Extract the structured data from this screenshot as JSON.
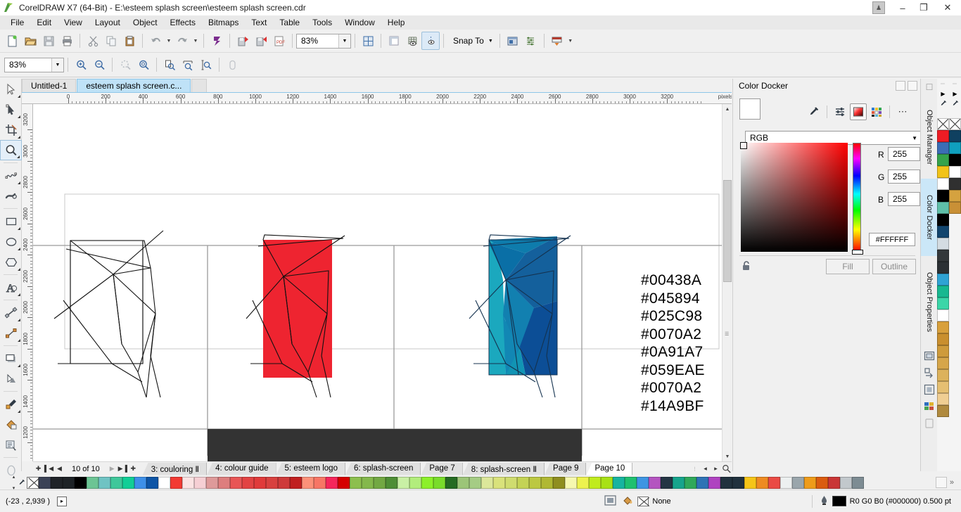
{
  "window": {
    "title": "CorelDRAW X7 (64-Bit) - E:\\esteem splash screen\\esteem splash screen.cdr",
    "logo_icon": "coreldraw-logo-icon",
    "minimize": "–",
    "maximize": "❐",
    "close": "✕",
    "account_icon": "user-account-icon"
  },
  "menubar": {
    "items": [
      {
        "label": "File",
        "accel": "F"
      },
      {
        "label": "Edit",
        "accel": "E"
      },
      {
        "label": "View",
        "accel": "V"
      },
      {
        "label": "Layout",
        "accel": "L"
      },
      {
        "label": "Object",
        "accel": "O"
      },
      {
        "label": "Effects",
        "accel": "c"
      },
      {
        "label": "Bitmaps",
        "accel": "B"
      },
      {
        "label": "Text",
        "accel": "x"
      },
      {
        "label": "Table",
        "accel": "T"
      },
      {
        "label": "Tools",
        "accel": "o"
      },
      {
        "label": "Window",
        "accel": "W"
      },
      {
        "label": "Help",
        "accel": "H"
      }
    ]
  },
  "toolbar_standard": {
    "buttons": [
      {
        "name": "new-document-icon",
        "tip": "New"
      },
      {
        "name": "open-document-icon",
        "tip": "Open"
      },
      {
        "name": "save-document-icon",
        "tip": "Save"
      },
      {
        "name": "print-icon",
        "tip": "Print"
      },
      {
        "name": "cut-icon",
        "tip": "Cut"
      },
      {
        "name": "copy-icon",
        "tip": "Copy"
      },
      {
        "name": "paste-icon",
        "tip": "Paste"
      },
      {
        "name": "undo-icon",
        "tip": "Undo"
      },
      {
        "name": "redo-icon",
        "tip": "Redo"
      },
      {
        "name": "corel-connect-icon",
        "tip": "Search Content"
      },
      {
        "name": "import-icon",
        "tip": "Import"
      },
      {
        "name": "export-icon",
        "tip": "Export"
      },
      {
        "name": "publish-pdf-icon",
        "tip": "Publish to PDF"
      }
    ],
    "zoom_value": "83%",
    "fullscreen_icon": "full-screen-preview-icon",
    "show_rulers_icon": "show-rulers-icon",
    "show_grid_icon": "show-grid-icon",
    "show_guides_icon": "show-guides-icon",
    "snap_to_label": "Snap To",
    "options_icon": "options-icon",
    "object-styles_icon": "object-styles-icon",
    "application_launcher_icon": "application-launcher-icon"
  },
  "toolbar_property": {
    "zoom_value": "83%",
    "buttons": [
      {
        "name": "zoom-in-icon"
      },
      {
        "name": "zoom-out-icon"
      },
      {
        "name": "zoom-to-selected-icon"
      },
      {
        "name": "zoom-to-all-objects-icon"
      },
      {
        "name": "zoom-to-page-icon"
      },
      {
        "name": "zoom-to-page-width-icon"
      },
      {
        "name": "zoom-to-page-height-icon"
      },
      {
        "name": "toggle-view-icon"
      }
    ]
  },
  "toolbox": {
    "tools": [
      {
        "name": "pick-tool",
        "label": "Pick",
        "flyout": true,
        "active": false
      },
      {
        "name": "shape-tool",
        "label": "Shape",
        "flyout": true,
        "active": false
      },
      {
        "name": "crop-tool",
        "label": "Crop",
        "flyout": true,
        "active": false
      },
      {
        "name": "zoom-tool",
        "label": "Zoom",
        "flyout": true,
        "active": true
      },
      {
        "name": "freehand-tool",
        "label": "Freehand",
        "flyout": true,
        "active": false
      },
      {
        "name": "artistic-media-tool",
        "label": "Artistic Media",
        "flyout": false,
        "active": false
      },
      {
        "name": "rectangle-tool",
        "label": "Rectangle",
        "flyout": true,
        "active": false
      },
      {
        "name": "ellipse-tool",
        "label": "Ellipse",
        "flyout": true,
        "active": false
      },
      {
        "name": "polygon-tool",
        "label": "Polygon",
        "flyout": true,
        "active": false
      },
      {
        "name": "text-tool",
        "label": "Text",
        "flyout": true,
        "active": false
      },
      {
        "name": "parallel-dimension-tool",
        "label": "Parallel Dimension",
        "flyout": true,
        "active": false
      },
      {
        "name": "straight-line-connector-tool",
        "label": "Straight-Line Connector",
        "flyout": true,
        "active": false
      },
      {
        "name": "drop-shadow-tool",
        "label": "Drop Shadow",
        "flyout": true,
        "active": false
      },
      {
        "name": "transparency-tool",
        "label": "Transparency",
        "flyout": false,
        "active": false
      },
      {
        "name": "color-eyedropper-tool",
        "label": "Color Eyedropper",
        "flyout": true,
        "active": false
      },
      {
        "name": "interactive-fill-tool",
        "label": "Interactive Fill",
        "flyout": false,
        "active": false
      },
      {
        "name": "smart-fill-tool",
        "label": "Smart Fill",
        "flyout": false,
        "active": false
      },
      {
        "name": "outline-pen-tool",
        "label": "Outline",
        "flyout": false,
        "active": false
      }
    ]
  },
  "document_tabs": [
    {
      "label": "Untitled-1",
      "active": false
    },
    {
      "label": "esteem splash screen.c...",
      "active": true
    }
  ],
  "ruler": {
    "unit": "pixels",
    "h_labels": [
      "0",
      "200",
      "400",
      "600",
      "800",
      "1000",
      "1200",
      "1400",
      "1600",
      "1800",
      "2000",
      "2200",
      "2400",
      "2600",
      "2800",
      "3000",
      "3200"
    ],
    "v_labels": [
      "3200",
      "3000",
      "2800",
      "2600",
      "2400",
      "2200",
      "2000",
      "1800",
      "1600",
      "1400",
      "1200"
    ]
  },
  "canvas": {
    "hex_list": [
      "#00438A",
      "#045894",
      "#025C98",
      "#0070A2",
      "#0A91A7",
      "#059EAE",
      "#0070A2",
      "#14A9BF"
    ],
    "artwork": {
      "panel1_label": "wireframe-polygon-drawing",
      "panel2_label": "red-polygon-drawing",
      "panel2_fill": "#EE2430",
      "panel3_label": "blue-polygon-drawing",
      "panel3_fills": [
        "#1BA8BE",
        "#0A6FA6",
        "#0E7CAC",
        "#14609C",
        "#0C4E96",
        "#1194B4"
      ],
      "dark_band_color": "#333333"
    }
  },
  "page_nav": {
    "add_page_start_icon": "add-page-icon",
    "first_icon": "▌◀",
    "prev_icon": "◀",
    "next_icon": "▶",
    "last_icon": "▶▐",
    "add_page_end_icon": "add-page-icon",
    "page_count_label": "10 of 10",
    "tabs": [
      {
        "label": "3: couloring Ⅱ",
        "active": false
      },
      {
        "label": "4: colour guide",
        "active": false
      },
      {
        "label": "5: esteem logo",
        "active": false
      },
      {
        "label": "6: splash-screen",
        "active": false
      },
      {
        "label": "Page 7",
        "active": false
      },
      {
        "label": "8: splash-screen Ⅱ",
        "active": false
      },
      {
        "label": "Page 9",
        "active": false
      },
      {
        "label": "Page 10",
        "active": true
      }
    ],
    "scroll_left_icon": "◂",
    "scroll_right_icon": "▸",
    "zoom_icon": "zoom-page-icon"
  },
  "color_docker": {
    "title": "Color Docker",
    "pin_icon": "pin-icon",
    "close_icon": "close-icon",
    "current_color": "#FFFFFF",
    "tools": [
      {
        "name": "eyedropper-icon",
        "selected": false
      },
      {
        "name": "color-sliders-icon",
        "selected": false
      },
      {
        "name": "color-viewers-icon",
        "selected": true
      },
      {
        "name": "color-palettes-icon",
        "selected": false
      },
      {
        "name": "more-options-icon",
        "selected": false
      }
    ],
    "model_label": "RGB",
    "channels": [
      {
        "label": "R",
        "value": "255"
      },
      {
        "label": "G",
        "value": "255"
      },
      {
        "label": "B",
        "value": "255"
      }
    ],
    "hex_value": "#FFFFFF",
    "lock_icon": "lock-open-icon",
    "fill_button": "Fill",
    "outline_button": "Outline"
  },
  "docker_tabs": [
    {
      "label": "Object Manager",
      "selected": false,
      "icon": "object-manager-icon"
    },
    {
      "label": "Color Docker",
      "selected": true,
      "icon": "color-docker-icon"
    },
    {
      "label": "Object Properties",
      "selected": false,
      "icon": "object-properties-icon"
    },
    {
      "label": "",
      "selected": false,
      "icon": "object-styles-icon"
    },
    {
      "label": "",
      "selected": false,
      "icon": "transformations-icon"
    },
    {
      "label": "",
      "selected": false,
      "icon": "object-data-icon"
    },
    {
      "label": "",
      "selected": false,
      "icon": "color-styles-icon"
    },
    {
      "label": "",
      "selected": false,
      "icon": "page-icon"
    }
  ],
  "palette_column_left": {
    "header_icon": "▶",
    "eyedropper_icon": "eyedropper-icon",
    "swatches": [
      "none",
      "#ED1C24",
      "#3B6DB5",
      "#35A34B",
      "#F2C318",
      "#FFFFFF",
      "#000000",
      "#5FBFA8",
      "#000000",
      "#12456E",
      "#D4DCE2",
      "#33383B",
      "#2B3034",
      "#2FA3D4",
      "#17B890",
      "#3BD6A8",
      "#FFFFFF",
      "#D8A03C",
      "#C98F2E",
      "#CE9B3B",
      "#D6A64A",
      "#DCB25C",
      "#E5BF72",
      "#F0CE93",
      "#B08A3E"
    ]
  },
  "palette_column_right": {
    "header_icon": "▶",
    "eyedropper_icon": "eyedropper-icon",
    "swatches": [
      "none",
      "#0F4060",
      "#0FA0BE",
      "#000000",
      "#FFFFFF",
      "#303030",
      "#D5A23F",
      "#C99036"
    ]
  },
  "bottom_palette": {
    "scroll_up_icon": "▴",
    "scroll_down_icon": "▾",
    "expand_icon": "»",
    "swatches": [
      "none",
      "#3B4256",
      "#1F2328",
      "#1D2226",
      "#000000",
      "#6CC494",
      "#6FC3C3",
      "#3FC79A",
      "#11CE96",
      "#3E90E8",
      "#0E55A6",
      "#FFFFFF",
      "#F23A33",
      "#FBE3E3",
      "#F6CFD4",
      "#DE9A9A",
      "#DD7E7E",
      "#E85656",
      "#E24343",
      "#E03A3A",
      "#D8413F",
      "#CE3A3A",
      "#C01F1F",
      "#FC9179",
      "#F77665",
      "#F5265B",
      "#D50000",
      "#8DBF4E",
      "#84B84C",
      "#72A843",
      "#4E8E35",
      "#C9F0A5",
      "#B2ED7C",
      "#8CF02A",
      "#79DC2B",
      "#256B22",
      "#9CC578",
      "#A5CC84",
      "#DCE79A",
      "#D9E27B",
      "#CFDC6F",
      "#C4D355",
      "#BCC842",
      "#B0B833",
      "#8F8E1F",
      "#F6F8B0",
      "#EDF24E",
      "#C0EB1E",
      "#A8E116",
      "#17B4A0",
      "#1FC06F",
      "#3E95E2",
      "#B454C0",
      "#243544",
      "#16A48C",
      "#2FA85A",
      "#2E73B5",
      "#AF42C0",
      "#20313E",
      "#20313E",
      "#F5C518",
      "#EE8B22",
      "#EA4B45",
      "#EDF0F0",
      "#9AA6AC",
      "#EE9C1A",
      "#DA5C10",
      "#C93636",
      "#C2C8CC",
      "#7D8C93"
    ]
  },
  "statusbar": {
    "coordinates": "(-23  , 2,939 )",
    "expand_icon": "▸",
    "snap_icon": "snap-indicator-icon",
    "fill_icon": "fill-bucket-icon",
    "fill_value": "None",
    "outline_icon": "outline-pen-icon",
    "outline_value": "R0 G0 B0 (#000000)  0.500 pt",
    "outline_color": "#000000"
  }
}
